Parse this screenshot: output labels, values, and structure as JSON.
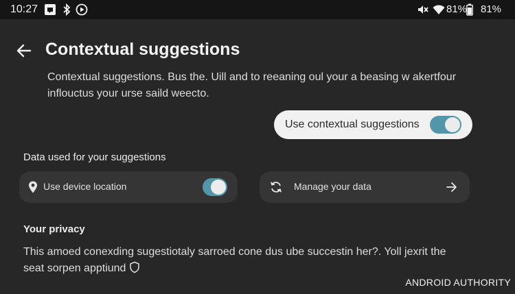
{
  "status_bar": {
    "time": "10:27",
    "signal_battery_label": "81%",
    "battery_label": "81%"
  },
  "header": {
    "title": "Contextual suggestions"
  },
  "description": "Contextual suggestions. Bus the. Uill and to reeaning oul your a beasing w akertfour inflouctus your urse saild weecto.",
  "main_toggle": {
    "label": "Use contextual suggestions",
    "enabled": true
  },
  "data_section": {
    "label": "Data used for your suggestions",
    "location": {
      "label": "Use device location",
      "enabled": true
    },
    "manage": {
      "label": "Manage your data"
    }
  },
  "privacy": {
    "heading": "Your privacy",
    "text": "This amoed conexding sugestiotaly sarroed cone dus ube succestin her?. Yoll jexrit the seat sorpen apptiund"
  },
  "watermark": "ANDROID AUTHORITY",
  "colors": {
    "background": "#272727",
    "status_bar": "#151515",
    "card": "#353535",
    "pill": "#f1f1f1",
    "accent": "#5196a9"
  }
}
